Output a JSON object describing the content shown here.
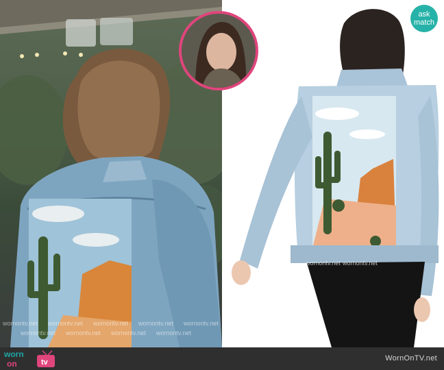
{
  "badge": {
    "line1": "ask",
    "line2": "match"
  },
  "watermark": {
    "text": "wornontv.net"
  },
  "footer": {
    "logo_word1": "worn",
    "logo_word2": "on",
    "logo_word3": "tv",
    "site_label": "WornOnTV.net"
  },
  "colors": {
    "badge": "#26b2a8",
    "inset_ring": "#e0457c",
    "footer_bg": "#2f2f2f",
    "logo_teal": "#1fa6a6",
    "logo_pink": "#e0457c"
  },
  "icons": {
    "logo_tv": "tv-icon"
  }
}
